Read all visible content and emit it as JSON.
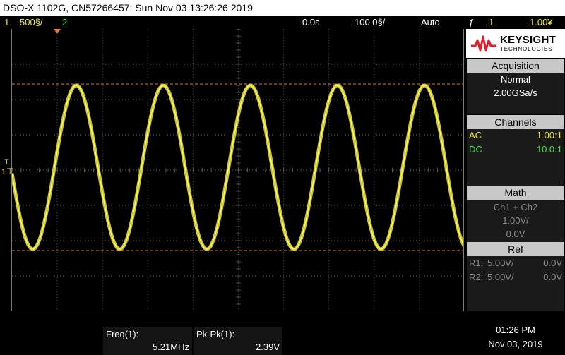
{
  "window": {
    "title": "DSO-X 1102G, CN57266457: Sun Nov 03 13:26:26 2019"
  },
  "status": {
    "ch1_num": "1",
    "ch1_scale": "500§/",
    "ch2_num": "2",
    "time_offset": "0.0s",
    "time_scale": "100.0§/",
    "trigger_mode": "Auto",
    "trigger_slope": "ƒ",
    "trigger_source": "1",
    "trigger_level": "1.00¥"
  },
  "logo": {
    "brand": "KEYSIGHT",
    "subtitle": "TECHNOLOGIES"
  },
  "acquisition": {
    "title": "Acquisition",
    "mode": "Normal",
    "rate": "2.00GSa/s"
  },
  "channels": {
    "title": "Channels",
    "rows": [
      {
        "coupling": "AC",
        "probe": "1.00:1",
        "color": "#f2ec1e"
      },
      {
        "coupling": "DC",
        "probe": "10.0:1",
        "color": "#3ce63c"
      }
    ]
  },
  "math": {
    "title": "Math",
    "function": "Ch1 + Ch2",
    "scale": "1.00V/",
    "offset": "0.0V"
  },
  "ref": {
    "title": "Ref",
    "rows": [
      {
        "name": "R1:",
        "scale": "5.00V/",
        "offset": "0.0V"
      },
      {
        "name": "R2:",
        "scale": "5.00V/",
        "offset": "0.0V"
      }
    ]
  },
  "measurements": [
    {
      "label": "Freq(1):",
      "value": "5.21MHz"
    },
    {
      "label": "Pk-Pk(1):",
      "value": "2.39V"
    }
  ],
  "clock": {
    "time": "01:26 PM",
    "date": "Nov 03, 2019"
  },
  "markers": {
    "trigger_level": "T",
    "ch1_ground": "1"
  },
  "colors": {
    "ch1": "#f2ec1e",
    "ch2": "#3ce63c",
    "cursor": "#e07a2c",
    "grid": "#5a5a5a"
  },
  "chart_data": {
    "type": "line",
    "series_color": "#f2ec1e",
    "cycles_on_screen": 5.2,
    "grid": true,
    "cursors": "horizontal dashed at waveform peak and trough"
  }
}
